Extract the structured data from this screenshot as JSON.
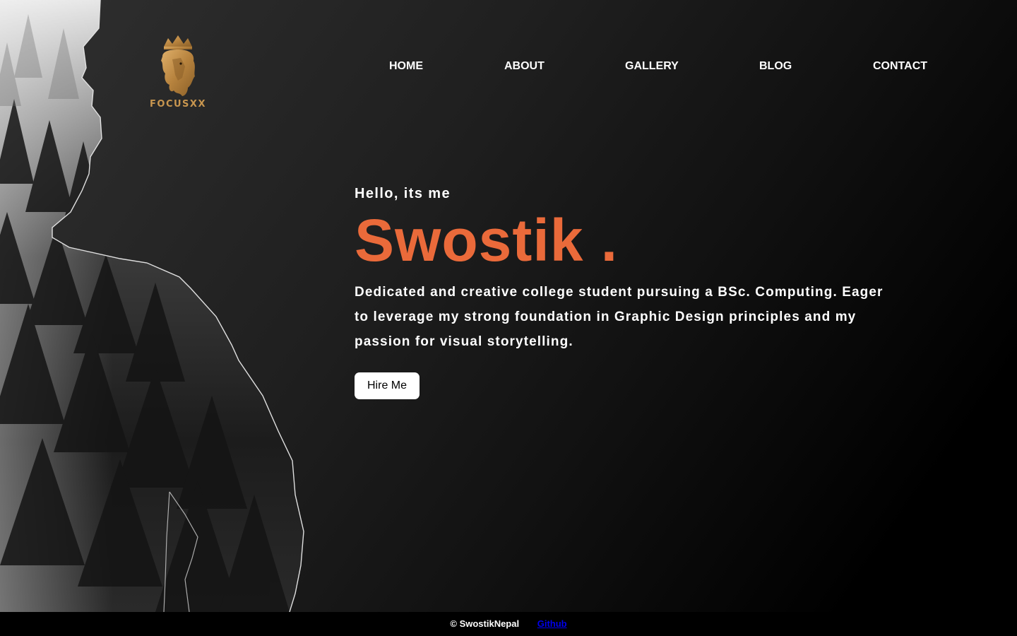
{
  "brand": {
    "logo_text": "FOCUSXX",
    "logo_icon": "crowned-lion-head-icon",
    "logo_color": "#c8964f"
  },
  "nav": {
    "items": [
      {
        "label": "HOME"
      },
      {
        "label": "ABOUT"
      },
      {
        "label": "GALLERY"
      },
      {
        "label": "BLOG"
      },
      {
        "label": "CONTACT"
      }
    ]
  },
  "hero": {
    "greeting": "Hello, its me",
    "name": "Swostik .",
    "description": "Dedicated and creative college student pursuing a BSc. Computing. Eager to leverage my strong foundation in Graphic Design principles and my passion for visual storytelling.",
    "cta_label": "Hire Me",
    "accent_color": "#ea6a3a",
    "background_image": "misty-forest-silhouette-of-person"
  },
  "footer": {
    "copyright": "© SwostikNepal",
    "github_label": "Github",
    "link_color": "#0000ee"
  }
}
